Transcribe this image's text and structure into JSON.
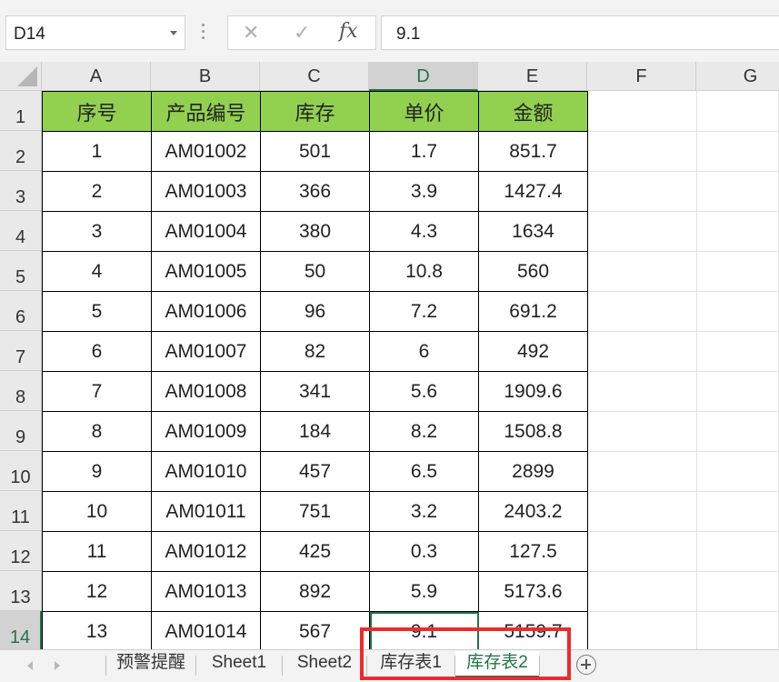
{
  "formula_bar": {
    "name_box": "D14",
    "cancel_icon": "close-icon",
    "enter_icon": "check-icon",
    "function_label": "fx",
    "formula_value": "9.1"
  },
  "columns": [
    "A",
    "B",
    "C",
    "D",
    "E",
    "F",
    "G"
  ],
  "selected_column": "D",
  "rows": [
    "1",
    "2",
    "3",
    "4",
    "5",
    "6",
    "7",
    "8",
    "9",
    "10",
    "11",
    "12",
    "13",
    "14"
  ],
  "selected_row": "14",
  "table": {
    "headers": [
      "序号",
      "产品编号",
      "库存",
      "单价",
      "金额"
    ],
    "header_fill": "#92d050",
    "rows": [
      [
        "1",
        "AM01002",
        "501",
        "1.7",
        "851.7"
      ],
      [
        "2",
        "AM01003",
        "366",
        "3.9",
        "1427.4"
      ],
      [
        "3",
        "AM01004",
        "380",
        "4.3",
        "1634"
      ],
      [
        "4",
        "AM01005",
        "50",
        "10.8",
        "560"
      ],
      [
        "5",
        "AM01006",
        "96",
        "7.2",
        "691.2"
      ],
      [
        "6",
        "AM01007",
        "82",
        "6",
        "492"
      ],
      [
        "7",
        "AM01008",
        "341",
        "5.6",
        "1909.6"
      ],
      [
        "8",
        "AM01009",
        "184",
        "8.2",
        "1508.8"
      ],
      [
        "9",
        "AM01010",
        "457",
        "6.5",
        "2899"
      ],
      [
        "10",
        "AM01011",
        "751",
        "3.2",
        "2403.2"
      ],
      [
        "11",
        "AM01012",
        "425",
        "0.3",
        "127.5"
      ],
      [
        "12",
        "AM01013",
        "892",
        "5.9",
        "5173.6"
      ],
      [
        "13",
        "AM01014",
        "567",
        "9.1",
        "5159.7"
      ]
    ]
  },
  "sheet_tabs": [
    "预警提醒",
    "Sheet1",
    "Sheet2",
    "库存表1",
    "库存表2"
  ],
  "active_sheet": "库存表2",
  "colors": {
    "accent": "#217346",
    "highlight_box": "#ee2b2b"
  }
}
